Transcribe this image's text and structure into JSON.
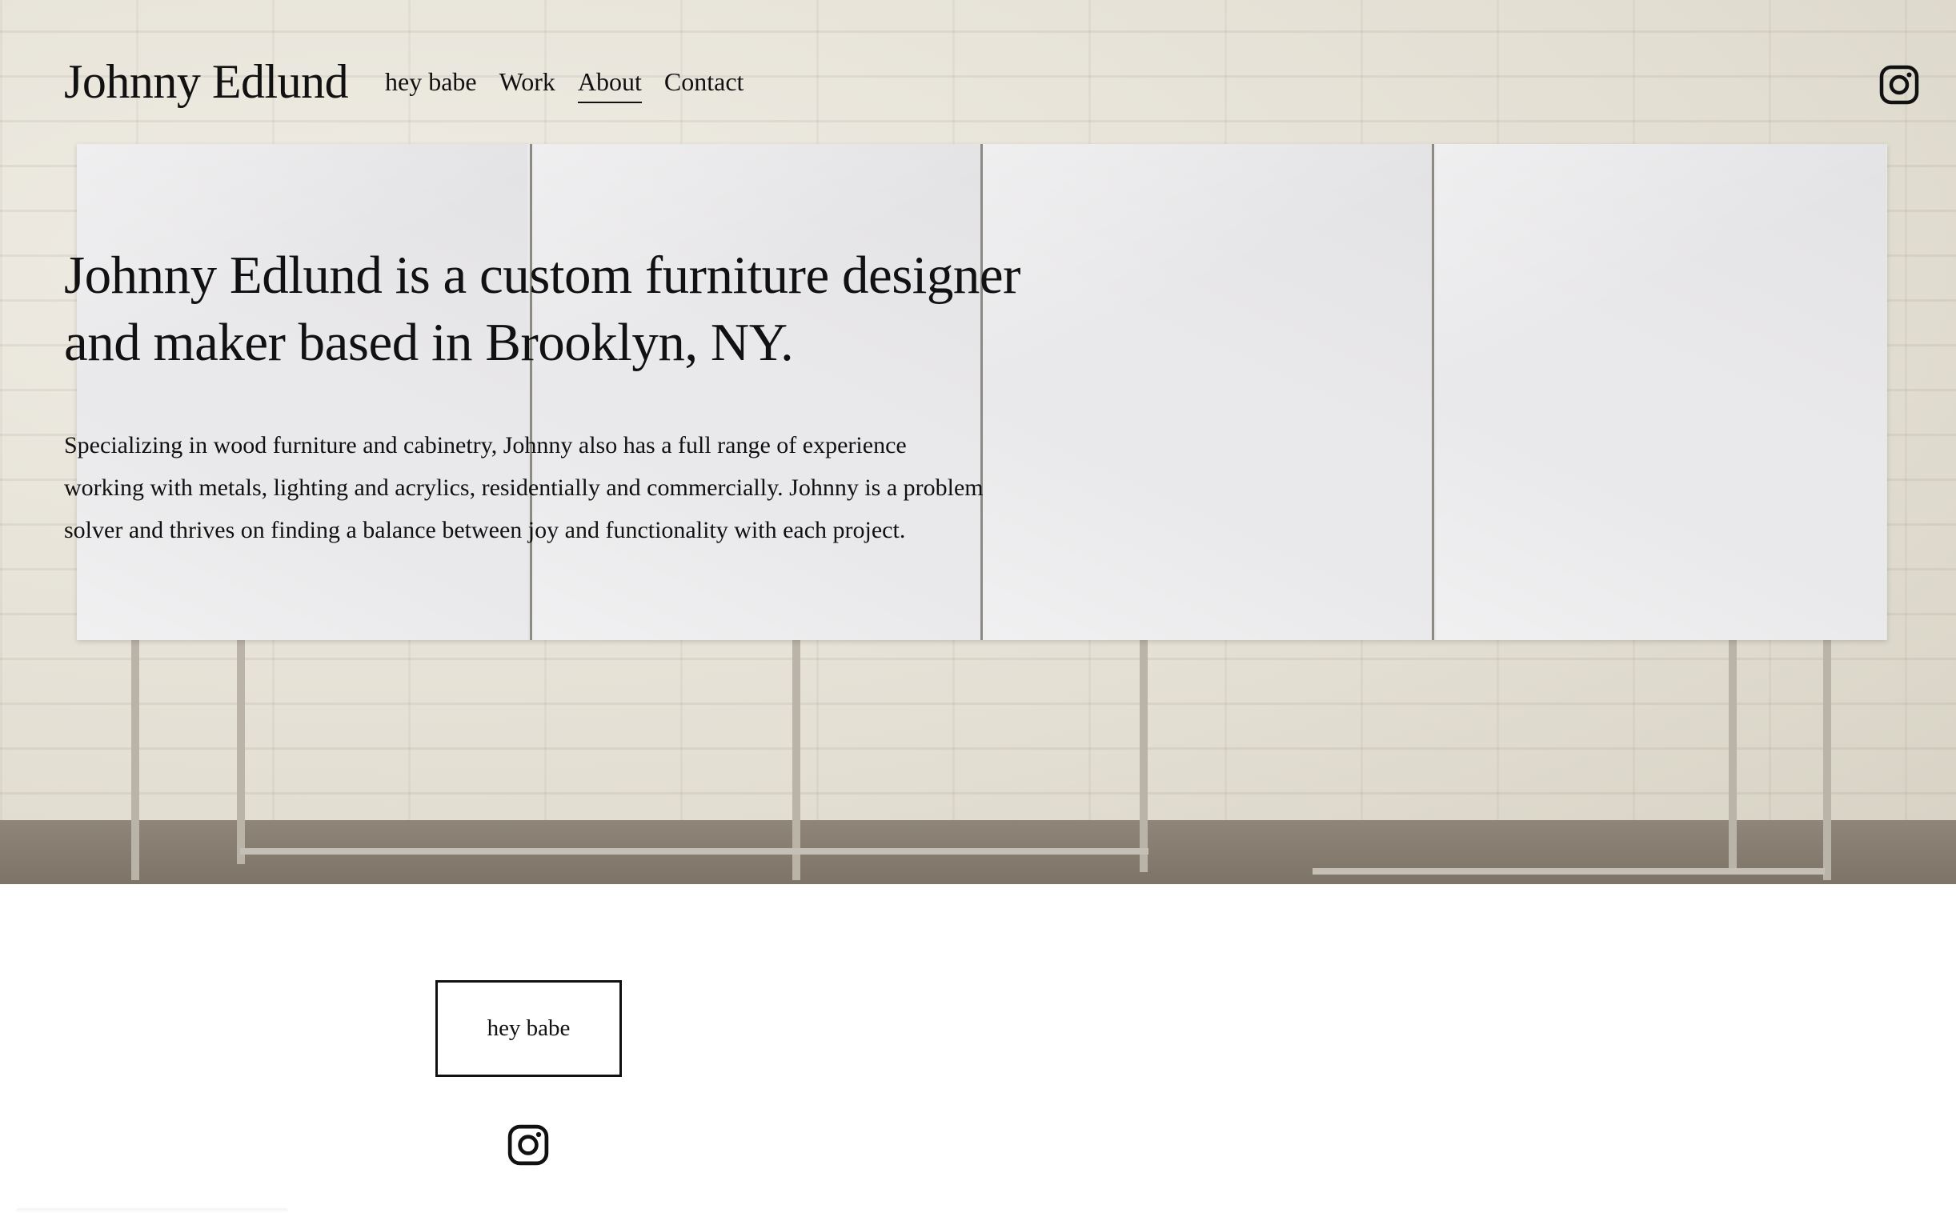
{
  "header": {
    "site_title": "Johnny Edlund",
    "nav": [
      {
        "label": "hey babe",
        "active": false
      },
      {
        "label": "Work",
        "active": false
      },
      {
        "label": "About",
        "active": true
      },
      {
        "label": "Contact",
        "active": false
      }
    ],
    "social_icon": "instagram-icon"
  },
  "hero": {
    "headline": "Johnny Edlund is a custom furniture designer and maker based in Brooklyn, NY.",
    "description": "Specializing in wood furniture and cabinetry, Johnny also has a full range of experience working with metals, lighting and acrylics, residentially and commercially. Johnny is a problem solver and thrives on finding a balance between joy and functionality with each project.",
    "background_image": "white geometric-panel credenza on metal legs in front of a painted brick wall"
  },
  "footer": {
    "button_label": "hey babe",
    "social_icon": "instagram-icon"
  },
  "colors": {
    "text": "#111111",
    "page_background": "#ffffff",
    "wall": "#e4e0d6",
    "cabinet": "#e9e8ea"
  }
}
